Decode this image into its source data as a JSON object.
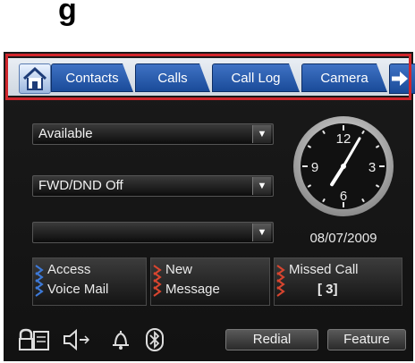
{
  "header_glyph": "g",
  "tabs": [
    {
      "label": "Contacts"
    },
    {
      "label": "Calls"
    },
    {
      "label": "Call Log"
    },
    {
      "label": "Camera"
    }
  ],
  "dropdowns": {
    "status": "Available",
    "forward": "FWD/DND Off",
    "third": ""
  },
  "clock": {
    "hour": 7,
    "minute": 5,
    "numerals": [
      "12",
      "3",
      "6",
      "9"
    ]
  },
  "date": "08/07/2009",
  "softkeys": {
    "access": {
      "line1": "Access",
      "line2": "Voice Mail"
    },
    "new": {
      "line1": "New",
      "line2": "Message"
    },
    "missed": {
      "line1": "Missed Call",
      "line2": "[ 3]"
    }
  },
  "buttons": {
    "redial": "Redial",
    "feature": "Feature"
  },
  "colors": {
    "tab_blue": "#2a5caf",
    "highlight_red": "#d0262c",
    "chevron_blue": "#3d7ad9",
    "chevron_red": "#d9452f"
  },
  "icons": [
    "home-icon",
    "arrow-right-icon",
    "phonebook-icon",
    "speaker-icon",
    "bell-icon",
    "bluetooth-icon"
  ]
}
